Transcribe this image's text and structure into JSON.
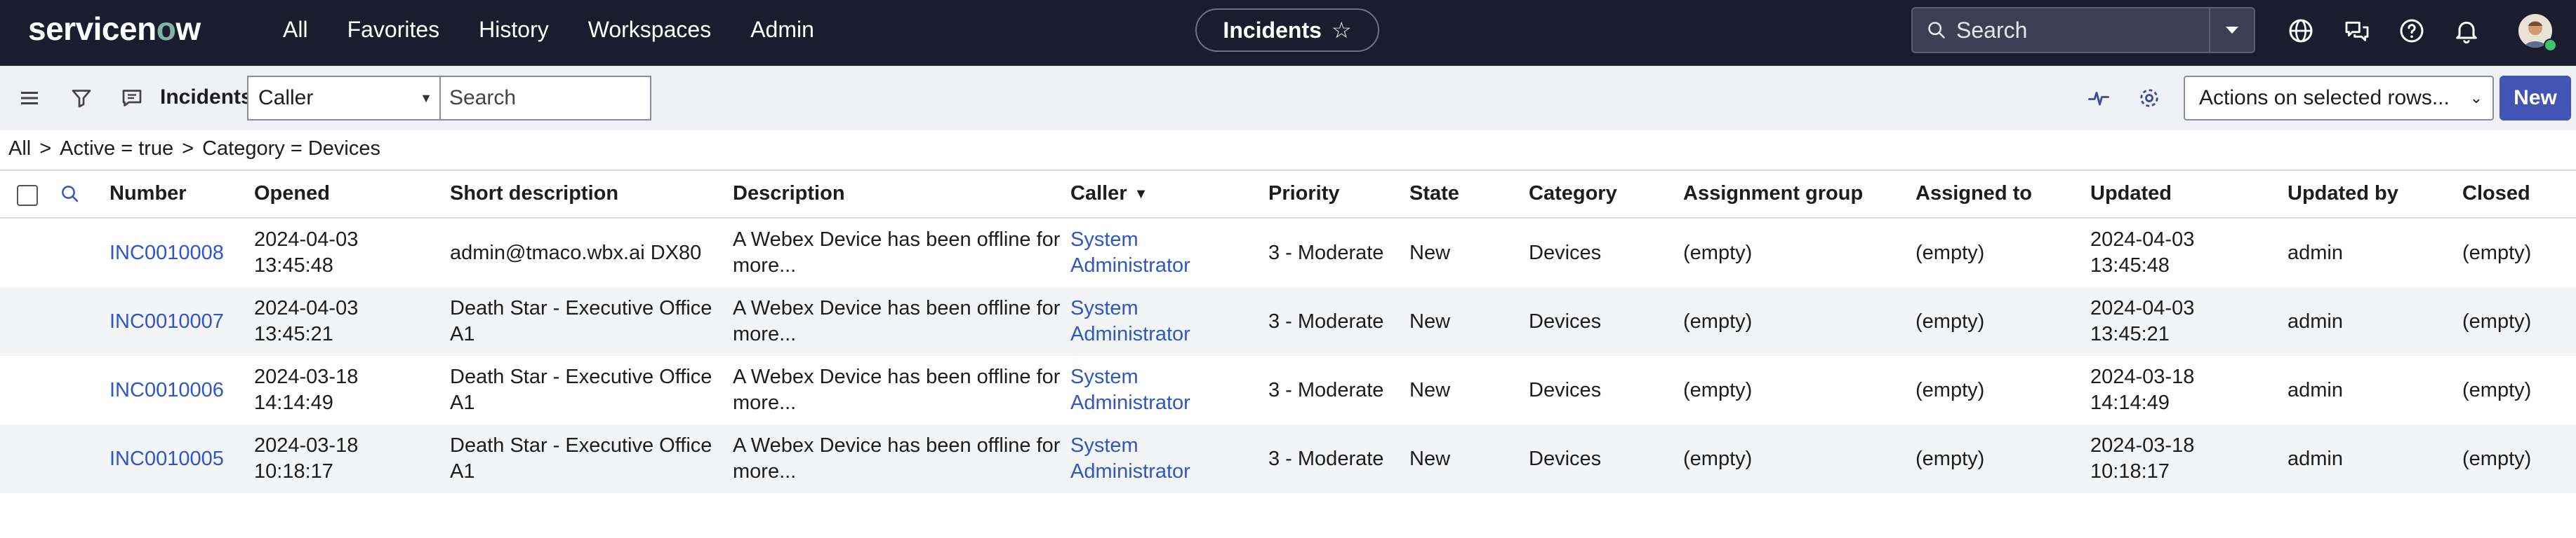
{
  "brand": {
    "logo_text_a": "servicen",
    "logo_text_o": "o",
    "logo_text_b": "w"
  },
  "nav": {
    "items": [
      "All",
      "Favorites",
      "History",
      "Workspaces",
      "Admin"
    ]
  },
  "context": {
    "label": "Incidents"
  },
  "global_search": {
    "placeholder": "Search"
  },
  "toolbar": {
    "title": "Incidents",
    "field_select_value": "Caller",
    "search_placeholder": "Search",
    "actions_label": "Actions on selected rows...",
    "new_label": "New"
  },
  "breadcrumb": {
    "items": [
      "All",
      "Active = true",
      "Category = Devices"
    ],
    "separator": ">"
  },
  "table": {
    "headers": {
      "number": "Number",
      "opened": "Opened",
      "short_description": "Short description",
      "description": "Description",
      "caller": "Caller",
      "priority": "Priority",
      "state": "State",
      "category": "Category",
      "assignment_group": "Assignment group",
      "assigned_to": "Assigned to",
      "updated": "Updated",
      "updated_by": "Updated by",
      "closed": "Closed"
    },
    "rows": [
      {
        "number": "INC0010008",
        "opened_date": "2024-04-03",
        "opened_time": "13:45:48",
        "short_desc_1": "admin@tmaco.wbx.ai DX80",
        "short_desc_2": "",
        "desc_1": "A Webex Device has been offline for",
        "desc_2": "more...",
        "caller_1": "System",
        "caller_2": "Administrator",
        "priority": "3 - Moderate",
        "state": "New",
        "category": "Devices",
        "assignment_group": "(empty)",
        "assigned_to": "(empty)",
        "updated_date": "2024-04-03",
        "updated_time": "13:45:48",
        "updated_by": "admin",
        "closed": "(empty)"
      },
      {
        "number": "INC0010007",
        "opened_date": "2024-04-03",
        "opened_time": "13:45:21",
        "short_desc_1": "Death Star - Executive Office",
        "short_desc_2": "A1",
        "desc_1": "A Webex Device has been offline for",
        "desc_2": "more...",
        "caller_1": "System",
        "caller_2": "Administrator",
        "priority": "3 - Moderate",
        "state": "New",
        "category": "Devices",
        "assignment_group": "(empty)",
        "assigned_to": "(empty)",
        "updated_date": "2024-04-03",
        "updated_time": "13:45:21",
        "updated_by": "admin",
        "closed": "(empty)"
      },
      {
        "number": "INC0010006",
        "opened_date": "2024-03-18",
        "opened_time": "14:14:49",
        "short_desc_1": "Death Star - Executive Office",
        "short_desc_2": "A1",
        "desc_1": "A Webex Device has been offline for",
        "desc_2": "more...",
        "caller_1": "System",
        "caller_2": "Administrator",
        "priority": "3 - Moderate",
        "state": "New",
        "category": "Devices",
        "assignment_group": "(empty)",
        "assigned_to": "(empty)",
        "updated_date": "2024-03-18",
        "updated_time": "14:14:49",
        "updated_by": "admin",
        "closed": "(empty)"
      },
      {
        "number": "INC0010005",
        "opened_date": "2024-03-18",
        "opened_time": "10:18:17",
        "short_desc_1": "Death Star - Executive Office",
        "short_desc_2": "A1",
        "desc_1": "A Webex Device has been offline for",
        "desc_2": "more...",
        "caller_1": "System",
        "caller_2": "Administrator",
        "priority": "3 - Moderate",
        "state": "New",
        "category": "Devices",
        "assignment_group": "(empty)",
        "assigned_to": "(empty)",
        "updated_date": "2024-03-18",
        "updated_time": "10:18:17",
        "updated_by": "admin",
        "closed": "(empty)"
      }
    ]
  },
  "colors": {
    "nav_bg": "#1b1d2e",
    "link": "#2f56c9",
    "primary_button": "#4254b4",
    "logo_accent": "#81b5a1"
  }
}
